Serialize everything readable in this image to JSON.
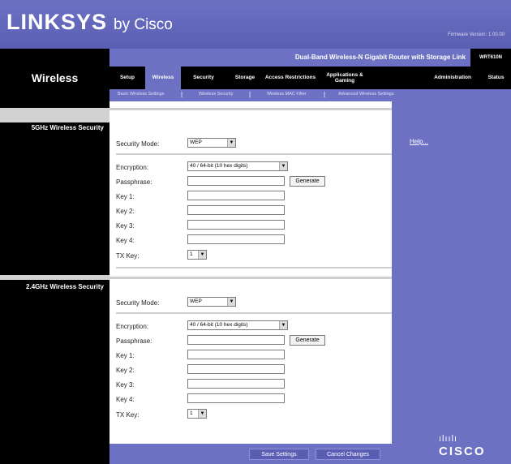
{
  "header": {
    "brand": "LINKSYS",
    "brand_suffix": "by Cisco",
    "firmware_version": "Firmware Version: 1.00.00"
  },
  "product": {
    "name": "Dual-Band Wireless-N Gigabit Router with Storage Link",
    "model": "WRT610N"
  },
  "section_title": "Wireless",
  "tabs": [
    {
      "label": "Setup",
      "active": false
    },
    {
      "label": "Wireless",
      "active": true
    },
    {
      "label": "Security",
      "active": false
    },
    {
      "label": "Storage",
      "active": false
    },
    {
      "label": "Access Restrictions",
      "active": false
    },
    {
      "label": "Applications & Gaming",
      "active": false
    },
    {
      "label": "Administration",
      "active": false
    },
    {
      "label": "Status",
      "active": false
    }
  ],
  "subtabs": [
    {
      "label": "Basic Wireless Settings"
    },
    {
      "label": "Wireless Security"
    },
    {
      "label": "Wireless MAC Filter"
    },
    {
      "label": "Advanced Wireless Settings"
    }
  ],
  "subtab_separator": "|",
  "sections": {
    "band5": {
      "title": "5GHz Wireless Security",
      "security_mode_label": "Security Mode:",
      "security_mode_value": "WEP",
      "encryption_label": "Encryption:",
      "encryption_value": "40 / 64-bit (10 hex digits)",
      "passphrase_label": "Passphrase:",
      "generate_label": "Generate",
      "key1_label": "Key 1:",
      "key2_label": "Key 2:",
      "key3_label": "Key 3:",
      "key4_label": "Key 4:",
      "txkey_label": "TX Key:",
      "txkey_value": "1"
    },
    "band24": {
      "title": "2.4GHz Wireless Security",
      "security_mode_label": "Security Mode:",
      "security_mode_value": "WEP",
      "encryption_label": "Encryption:",
      "encryption_value": "40 / 64-bit (10 hex digits)",
      "passphrase_label": "Passphrase:",
      "generate_label": "Generate",
      "key1_label": "Key 1:",
      "key2_label": "Key 2:",
      "key3_label": "Key 3:",
      "key4_label": "Key 4:",
      "txkey_label": "TX Key:",
      "txkey_value": "1"
    }
  },
  "help_link": "Help...",
  "buttons": {
    "save": "Save Settings",
    "cancel": "Cancel Changes"
  },
  "cisco_logo": {
    "bars": "ılıılı",
    "word": "CISCO"
  },
  "select_arrow_glyph": "▼",
  "colors": {
    "brand_purple": "#6c71c4",
    "black": "#000000"
  }
}
